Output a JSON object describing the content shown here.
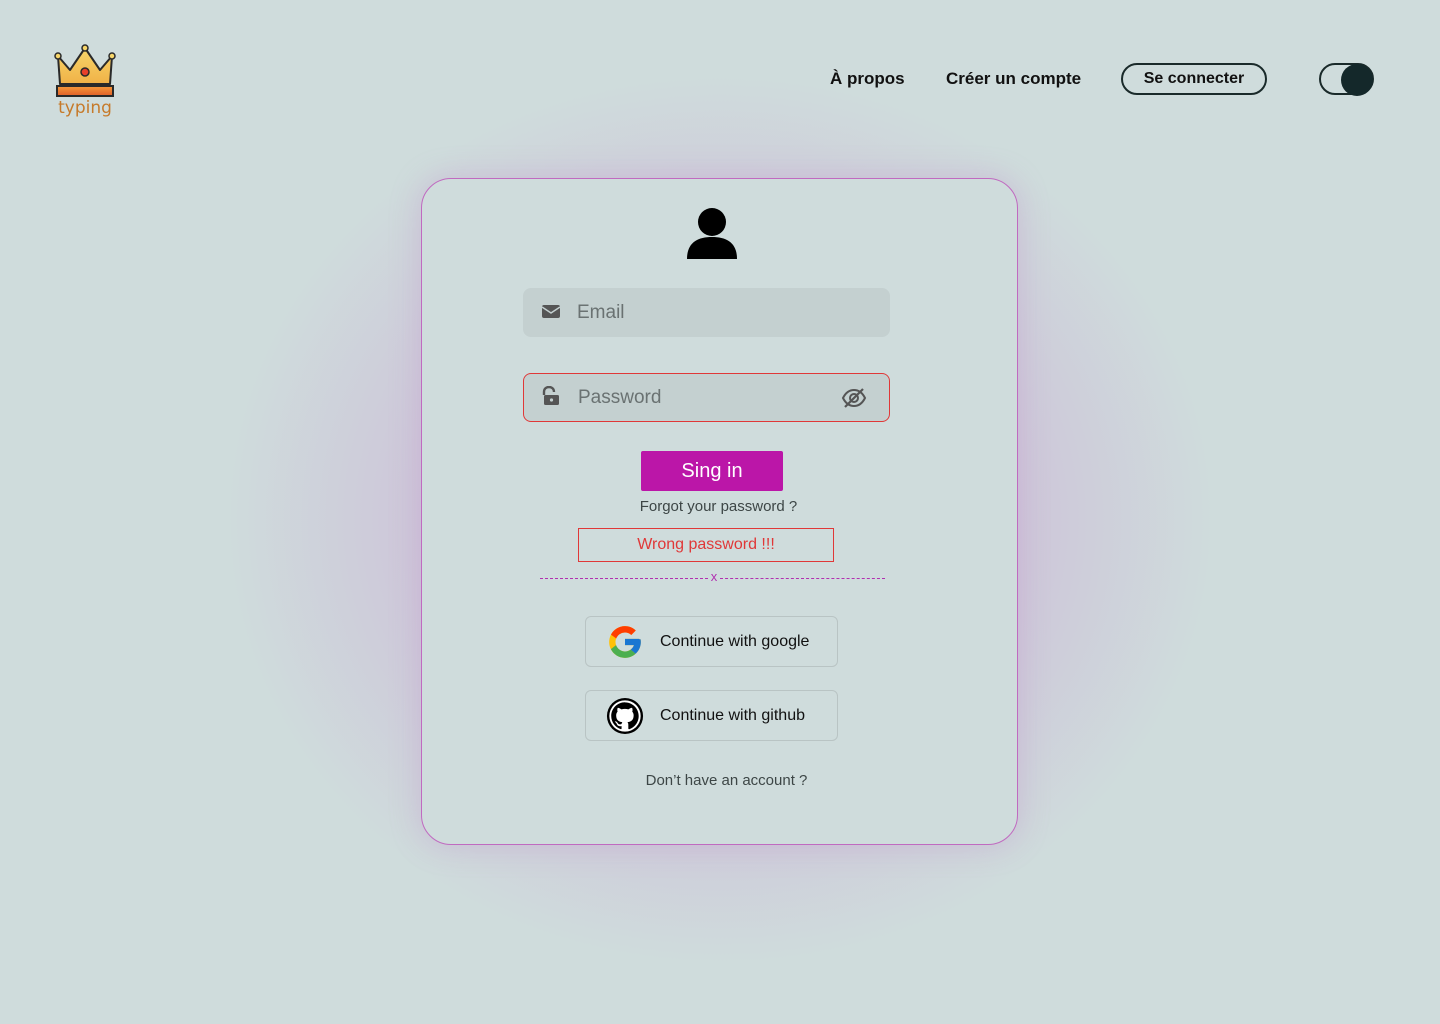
{
  "header": {
    "logo_text": "typing",
    "nav": {
      "about": "À propos",
      "create_account": "Créer un compte",
      "login": "Se connecter"
    }
  },
  "login_form": {
    "email": {
      "placeholder": "Email",
      "value": ""
    },
    "password": {
      "placeholder": "Password",
      "value": ""
    },
    "submit_label": "Sing in",
    "forgot_password": "Forgot your password ?",
    "error_message": "Wrong password !!!",
    "divider_text": "x",
    "oauth": {
      "google_label": "Continue with google",
      "github_label": "Continue with github"
    },
    "no_account": "Don’t have an account ?"
  },
  "colors": {
    "background": "#cfdcdc",
    "accent": "#bb16a8",
    "error": "#e03838",
    "logo_text": "#c67a2a"
  },
  "icons": {
    "logo": "crown-icon",
    "avatar": "user-icon",
    "email": "envelope-icon",
    "password": "lock-open-icon",
    "password_toggle": "eye-slash-icon",
    "google": "google-icon",
    "github": "github-icon"
  }
}
